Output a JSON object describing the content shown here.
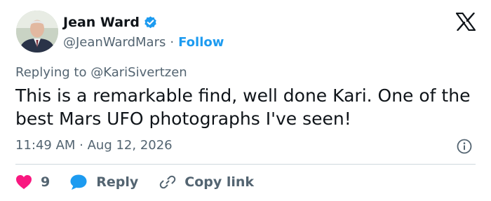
{
  "author": {
    "display_name": "Jean Ward",
    "handle": "@JeanWardMars",
    "separator": "·",
    "follow_label": "Follow",
    "verified_icon": "verified-badge-icon",
    "avatar_icon": "avatar"
  },
  "platform": {
    "logo_icon": "x-logo-icon"
  },
  "reply_context": {
    "prefix": "Replying to",
    "mention": "@KariSivertzen"
  },
  "tweet": {
    "text": "This is a remarkable find, well done Kari. One of the best Mars UFO photographs I've seen!",
    "timestamp": "11:49 AM · Aug 12, 2026"
  },
  "actions": {
    "like_count": "9",
    "reply_label": "Reply",
    "copy_label": "Copy link"
  },
  "colors": {
    "accent": "#1d9bf0",
    "like": "#f91880",
    "text": "#0f1419",
    "muted": "#536471"
  }
}
